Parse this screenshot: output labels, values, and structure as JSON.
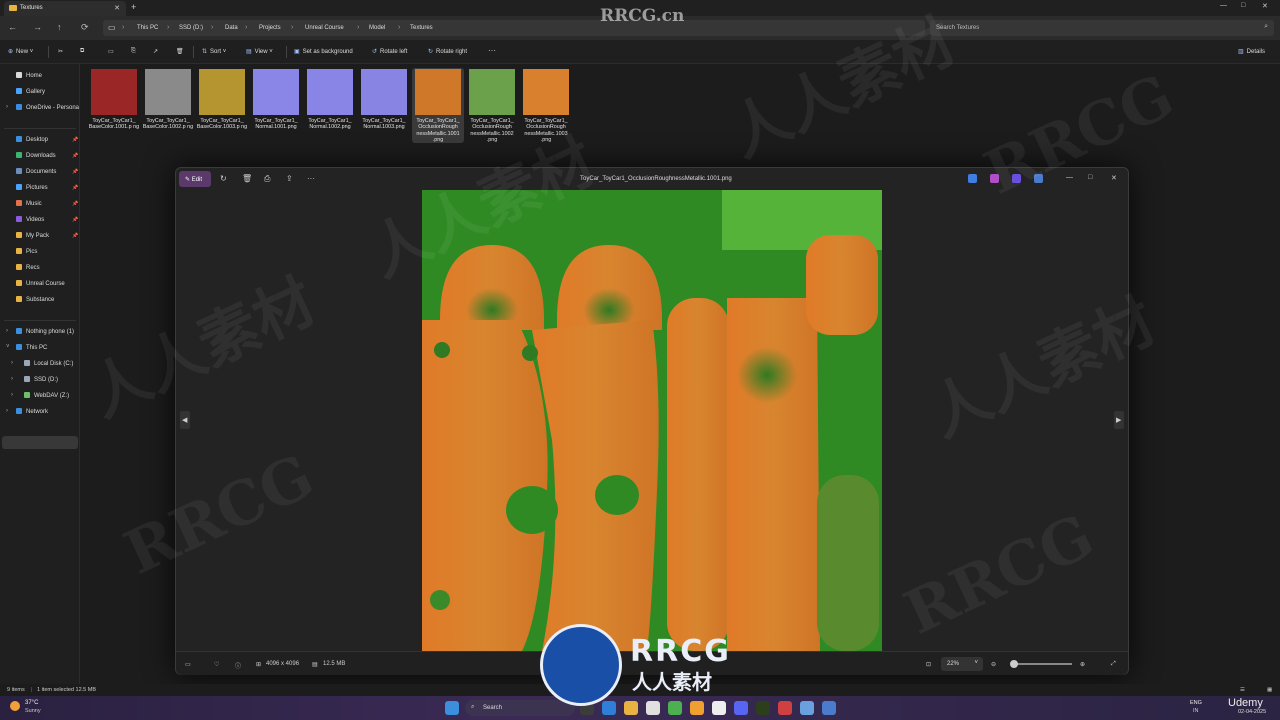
{
  "window": {
    "tab_title": "Textures",
    "new_tab": "+",
    "controls": {
      "minimize": "—",
      "maximize": "□",
      "close": "✕"
    }
  },
  "nav": {
    "back": "←",
    "forward": "→",
    "up": "↑",
    "refresh": "⟳"
  },
  "breadcrumb": [
    "This PC",
    "SSD (D:)",
    "Data",
    "Projects",
    "Unreal Course",
    "Model",
    "Textures"
  ],
  "search": {
    "placeholder": "Search Textures"
  },
  "toolbar": {
    "new": "New",
    "sort": "Sort",
    "view": "View",
    "set_background": "Set as background",
    "rotate_left": "Rotate left",
    "rotate_right": "Rotate right",
    "more": "···",
    "details": "Details"
  },
  "sidebar": {
    "top": [
      {
        "label": "Home",
        "icon": "home-icon",
        "color": "#d9d9d9"
      },
      {
        "label": "Gallery",
        "icon": "gallery-icon",
        "color": "#4aa3ff"
      },
      {
        "label": "OneDrive - Persona",
        "icon": "cloud-icon",
        "color": "#3a8de0"
      }
    ],
    "pinned": [
      {
        "label": "Desktop",
        "icon": "desktop-icon",
        "color": "#3b8fdc"
      },
      {
        "label": "Downloads",
        "icon": "download-icon",
        "color": "#3cb371"
      },
      {
        "label": "Documents",
        "icon": "documents-icon",
        "color": "#6c8ebf"
      },
      {
        "label": "Pictures",
        "icon": "pictures-icon",
        "color": "#4aa3ff"
      },
      {
        "label": "Music",
        "icon": "music-icon",
        "color": "#e0734a"
      },
      {
        "label": "Videos",
        "icon": "videos-icon",
        "color": "#8c5cdc"
      },
      {
        "label": "My Pack",
        "icon": "folder-icon",
        "color": "#e8b341"
      },
      {
        "label": "Pics",
        "icon": "folder-icon",
        "color": "#e8b341"
      },
      {
        "label": "Recs",
        "icon": "folder-icon",
        "color": "#e8b341"
      },
      {
        "label": "Unreal Course",
        "icon": "folder-icon",
        "color": "#e8b341"
      },
      {
        "label": "Substance",
        "icon": "folder-icon",
        "color": "#e8b341"
      }
    ],
    "devices": [
      {
        "label": "Nothing phone (1)",
        "icon": "phone-icon",
        "color": "#3b8fdc"
      },
      {
        "label": "This PC",
        "icon": "pc-icon",
        "color": "#3b8fdc"
      },
      {
        "label": "Local Disk (C:)",
        "icon": "drive-icon",
        "color": "#9aa7b5"
      },
      {
        "label": "SSD (D:)",
        "icon": "drive-icon",
        "color": "#9aa7b5"
      },
      {
        "label": "WebDAV (Z:)",
        "icon": "network-drive-icon",
        "color": "#6cbf6c"
      },
      {
        "label": "Network",
        "icon": "network-icon",
        "color": "#3b8fdc"
      }
    ]
  },
  "files": [
    {
      "name": "ToyCar_ToyCar1_ BaseColor.1001.p ng",
      "thumb": "#9b2626"
    },
    {
      "name": "ToyCar_ToyCar1_ BaseColor.1002.p ng",
      "thumb": "#8a8a8a"
    },
    {
      "name": "ToyCar_ToyCar1_ BaseColor.1003.p ng",
      "thumb": "#b49530"
    },
    {
      "name": "ToyCar_ToyCar1_ Normal.1001.png",
      "thumb": "#8a86e8"
    },
    {
      "name": "ToyCar_ToyCar1_ Normal.1002.png",
      "thumb": "#8985e6"
    },
    {
      "name": "ToyCar_ToyCar1_ Normal.1003.png",
      "thumb": "#8884e4"
    },
    {
      "name": "ToyCar_ToyCar1_ OcclusionRough nessMetallic.1001 .png",
      "thumb": "#d0782a"
    },
    {
      "name": "ToyCar_ToyCar1_ OcclusionRough nessMetallic.1002 .png",
      "thumb": "#6aa14a"
    },
    {
      "name": "ToyCar_ToyCar1_ OcclusionRough nessMetallic.1003 .png",
      "thumb": "#d8802e"
    }
  ],
  "viewer": {
    "title": "ToyCar_ToyCar1_OcclusionRoughnessMetallic.1001.png",
    "edit": "Edit",
    "dimensions": "4096 x 4096",
    "filesize": "12.5 MB",
    "zoom": "22%",
    "prev": "◀",
    "next": "▶"
  },
  "status": {
    "items": "9 items",
    "selected": "1 item selected 12.5 MB"
  },
  "taskbar": {
    "weather_temp": "37°C",
    "weather_text": "Sunny",
    "search": "Search",
    "lang1": "ENG",
    "lang2": "IN",
    "date": "02-04-2025"
  },
  "watermark": {
    "site": "RRCG.cn",
    "brand": "RRCG",
    "cn": "人人素材",
    "udemy": "Udemy"
  }
}
